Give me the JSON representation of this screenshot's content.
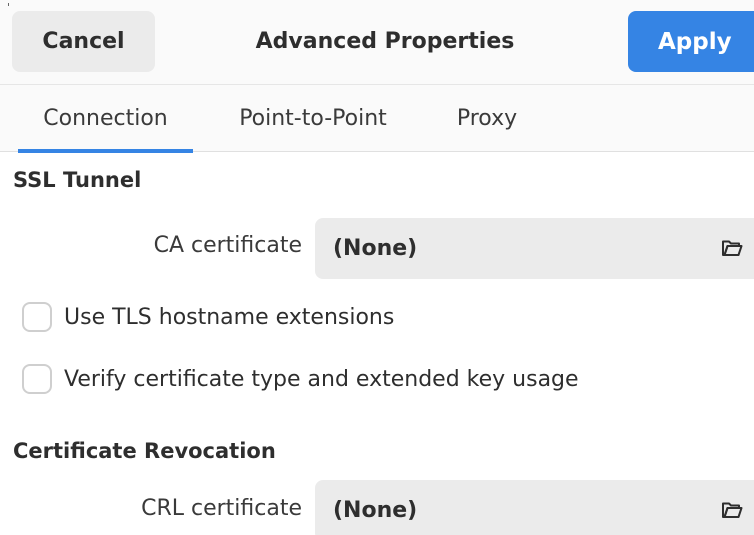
{
  "header": {
    "cancel_label": "Cancel",
    "title": "Advanced Properties",
    "apply_label": "Apply"
  },
  "tabs": [
    {
      "label": "Connection",
      "active": true
    },
    {
      "label": "Point-to-Point",
      "active": false
    },
    {
      "label": "Proxy",
      "active": false
    }
  ],
  "ssl_tunnel": {
    "section_title": "SSL Tunnel",
    "ca_certificate": {
      "label": "CA certificate",
      "value": "(None)",
      "icon": "folder-open-icon"
    },
    "use_tls_hostname": {
      "label": "Use TLS hostname extensions",
      "checked": false
    },
    "verify_cert_type": {
      "label": "Verify certificate type and extended key usage",
      "checked": false
    }
  },
  "cert_revocation": {
    "section_title": "Certificate Revocation",
    "crl_certificate": {
      "label": "CRL certificate",
      "value": "(None)",
      "icon": "folder-open-icon"
    }
  },
  "colors": {
    "accent": "#3584e4",
    "button_bg": "#ebebeb",
    "header_bg": "#fafafa"
  }
}
